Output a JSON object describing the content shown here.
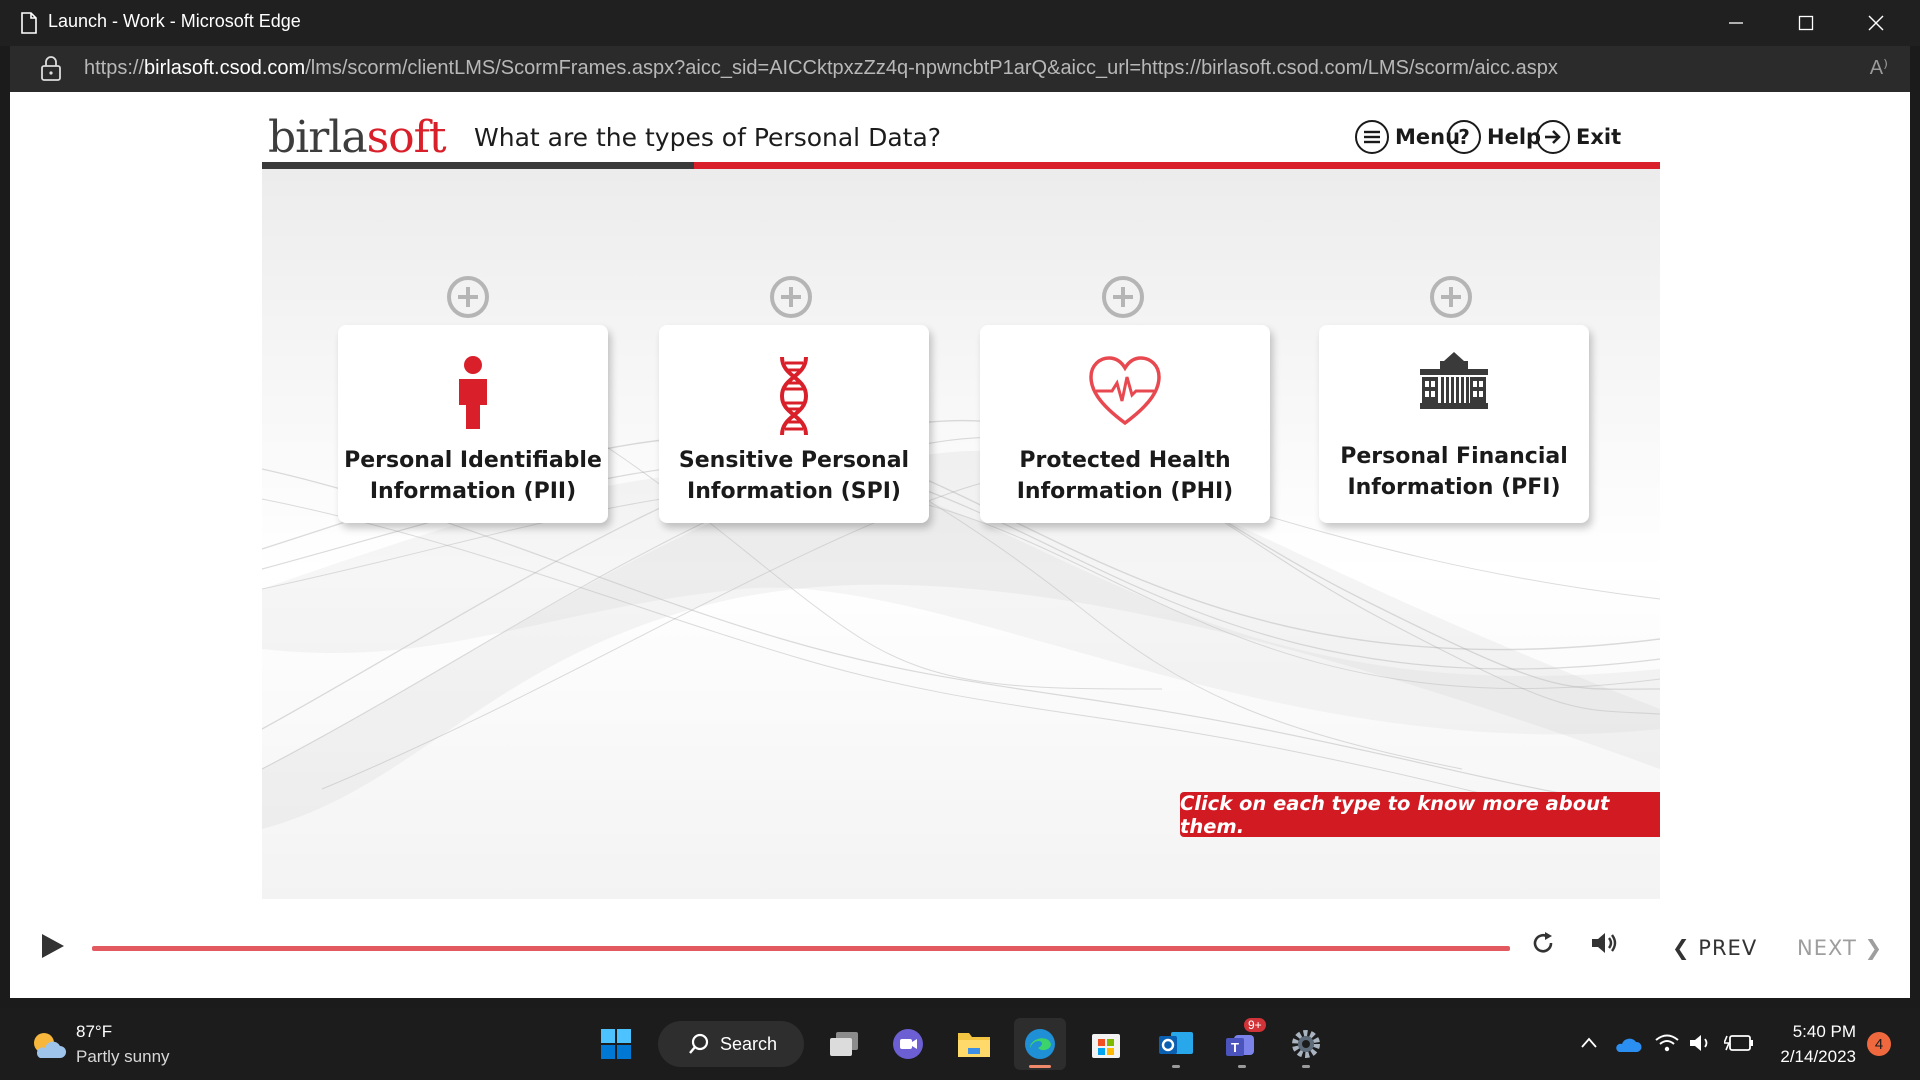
{
  "window": {
    "title": "Launch - Work - Microsoft Edge",
    "minimize_icon": "minimize-icon",
    "maximize_icon": "maximize-icon",
    "close_icon": "close-icon"
  },
  "address_bar": {
    "url_prefix": "https://",
    "url_domain": "birlasoft.csod.com",
    "url_path": "/lms/scorm/clientLMS/ScormFrames.aspx?aicc_sid=AICCktpxzZz4q-npwncbtP1arQ&aicc_url=https://birlasoft.csod.com/LMS/scorm/aicc.aspx",
    "read_aloud": "A⁾"
  },
  "course": {
    "logo_dark": "birla",
    "logo_red": "soft",
    "title": "What are the types of Personal Data?",
    "menu_label": "Menu",
    "help_label": "Help",
    "exit_label": "Exit",
    "help_glyph": "?",
    "cards": [
      {
        "label_line1": "Personal Identifiable",
        "label_line2": "Information (PII)",
        "icon": "person-icon"
      },
      {
        "label_line1": "Sensitive Personal",
        "label_line2": "Information (SPI)",
        "icon": "dna-icon"
      },
      {
        "label_line1": "Protected Health",
        "label_line2": "Information (PHI)",
        "icon": "heart-pulse-icon"
      },
      {
        "label_line1": "Personal Financial",
        "label_line2": "Information (PFI)",
        "icon": "bank-building-icon"
      }
    ],
    "instruction": "Click on each type to know more about them.",
    "accent_color": "#d9202a"
  },
  "player": {
    "prev_label": "PREV",
    "next_label": "NEXT",
    "progress": 1.0
  },
  "taskbar": {
    "weather_temp": "87°F",
    "weather_desc": "Partly sunny",
    "search_label": "Search",
    "teams_badge": "9+",
    "time": "5:40 PM",
    "date": "2/14/2023",
    "notification_count": "4"
  }
}
